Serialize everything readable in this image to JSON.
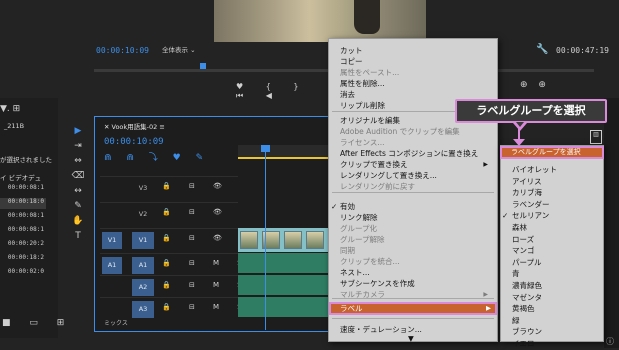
{
  "monitor": {
    "timecode": "00:00:10:09",
    "fit": "全体表示",
    "duration": "00:00:47:19",
    "transport_icons": "♥ { } ⏮ ◀",
    "transport_right": "⊕ ⊕"
  },
  "left_panel": {
    "filter_icons": "▼. ⊞",
    "bin_name": "_211B",
    "selected_msg": "が選択されました",
    "col_header": "イ  ビデオデュ",
    "rows": [
      "00:00:08:1",
      "00:00:18:0",
      "00:00:08:1",
      "00:00:08:1",
      "00:00:20:2",
      "00:00:18:2",
      "00:00:02:0"
    ],
    "bottom_icons": "■ ▭ ⊞"
  },
  "tools": [
    "▶",
    "⇥",
    "⇔",
    "⌫",
    "↔",
    "✎",
    "✋",
    "T"
  ],
  "timeline": {
    "sequence_name": "Vook用語集-02",
    "timecode": "00:00:10:09",
    "tool_icons": "⋒ ⋒ ⤵ ♥ ✎",
    "tracks": [
      {
        "source": "",
        "target": "V3",
        "controls": "🔒 ⊟ 👁"
      },
      {
        "source": "",
        "target": "V2",
        "controls": "🔒 ⊟ 👁"
      },
      {
        "source": "V1",
        "target": "V1",
        "controls": "🔒 ⊟ 👁"
      },
      {
        "source": "A1",
        "target": "A1",
        "controls": "🔒 ⊟ M S 🎤"
      },
      {
        "source": "",
        "target": "A2",
        "controls": "🔒 ⊟ M S 🎤"
      },
      {
        "source": "",
        "target": "A3",
        "controls": "🔒 ⊟ M S 🎤"
      }
    ],
    "mix_label": "ミックス"
  },
  "context_menu": {
    "items": [
      {
        "label": "カット",
        "disabled": false
      },
      {
        "label": "コピー",
        "disabled": false
      },
      {
        "label": "属性をペースト...",
        "disabled": true
      },
      {
        "label": "属性を削除...",
        "disabled": false
      },
      {
        "label": "消去",
        "disabled": false
      },
      {
        "label": "リップル削除",
        "disabled": false
      },
      {
        "label": "オリジナルを編集",
        "disabled": false
      },
      {
        "label": "Adobe Audition でクリップを編集",
        "disabled": true
      },
      {
        "label": "ライセンス...",
        "disabled": true
      },
      {
        "label": "After Effects コンポジションに置き換え",
        "disabled": false
      },
      {
        "label": "クリップで置き換え",
        "disabled": false
      },
      {
        "label": "レンダリングして置き換え...",
        "disabled": false
      },
      {
        "label": "レンダリング前に戻す",
        "disabled": true
      },
      {
        "label": "有効",
        "disabled": false
      },
      {
        "label": "リンク解除",
        "disabled": false
      },
      {
        "label": "グループ化",
        "disabled": true
      },
      {
        "label": "グループ解除",
        "disabled": true
      },
      {
        "label": "同期",
        "disabled": true
      },
      {
        "label": "クリップを統合...",
        "disabled": true
      },
      {
        "label": "ネスト...",
        "disabled": false
      },
      {
        "label": "サブシーケンスを作成",
        "disabled": false
      },
      {
        "label": "マルチカメラ",
        "disabled": true
      },
      {
        "label": "ラベル",
        "disabled": false
      },
      {
        "label": "速度・デュレーション...",
        "disabled": false
      }
    ],
    "submenu_arrow": "▶",
    "scroll_arrow": "▼"
  },
  "label_submenu": {
    "highlight": "ラベルグループを選択",
    "items": [
      "バイオレット",
      "アイリス",
      "カリブ海",
      "ラベンダー",
      "セルリアン",
      "森林",
      "ローズ",
      "マンゴ",
      "パープル",
      "青",
      "濃青緑色",
      "マゼンタ",
      "黄褐色",
      "緑",
      "ブラウン",
      "イエロー"
    ],
    "checked": "セルリアン"
  },
  "callout": {
    "text": "ラベルグループを選択"
  },
  "colors": {
    "accent": "#3c8ee8",
    "menu_highlight": "#c8622f",
    "callout_border": "#d98ad9",
    "clip_video": "#85c0c6",
    "clip_audio": "#2f7d63"
  }
}
